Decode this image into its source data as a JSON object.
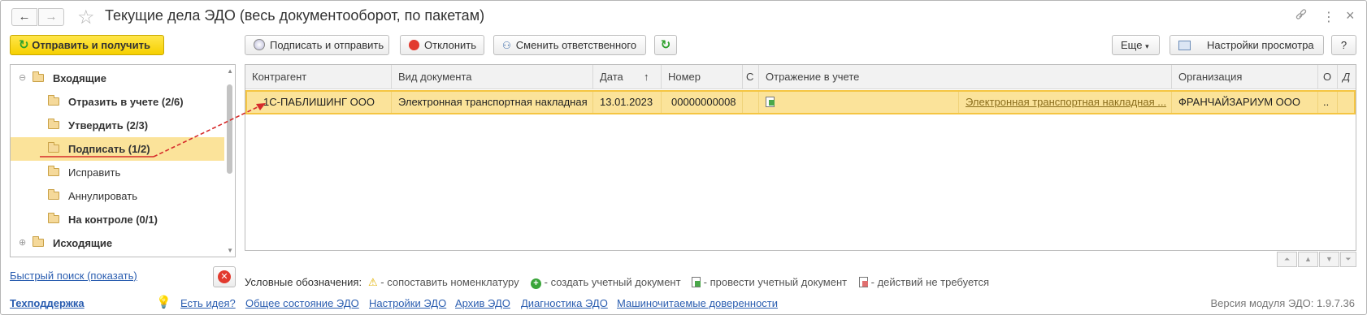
{
  "window": {
    "title": "Текущие дела ЭДО (весь документооборот, по пакетам)",
    "back_icon": "←",
    "forward_icon": "→",
    "link_icon": "🔗",
    "more_icon": "⋮",
    "close_icon": "×"
  },
  "toolbar": {
    "send_receive": "Отправить и получить",
    "sign_send": "Подписать и отправить",
    "reject": "Отклонить",
    "change_responsible": "Сменить ответственного",
    "more": "Еще",
    "view_settings": "Настройки просмотра",
    "help": "?"
  },
  "tree": {
    "items": [
      {
        "label": "Входящие",
        "toggle": "⊖",
        "bold": true
      },
      {
        "label": "Отразить в учете (2/6)",
        "bold": true
      },
      {
        "label": "Утвердить (2/3)",
        "bold": true
      },
      {
        "label": "Подписать (1/2)",
        "bold": true,
        "selected": true
      },
      {
        "label": "Исправить",
        "bold": false
      },
      {
        "label": "Аннулировать",
        "bold": false
      },
      {
        "label": "На контроле (0/1)",
        "bold": true
      },
      {
        "label": "Исходящие",
        "toggle": "⊕",
        "bold": true
      }
    ]
  },
  "grid": {
    "columns": [
      "Контрагент",
      "Вид документа",
      "Дата",
      "Номер",
      "С",
      "Отражение в учете",
      "Организация",
      "О",
      "Д"
    ],
    "sort_indicator": "↑",
    "rows": [
      {
        "counterparty": "1С-ПАБЛИШИНГ ООО",
        "doc_type": "Электронная транспортная накладная",
        "date": "13.01.2023",
        "number": "00000000008",
        "accounting_link": "Электронная транспортная накладная ...",
        "organization": "ФРАНЧАЙЗАРИУМ ООО",
        "extra": ".."
      }
    ]
  },
  "quick_search": "Быстрый поиск (показать)",
  "legend": {
    "title": "Условные обозначения:",
    "items": [
      "- сопоставить номенклатуру",
      "- создать учетный документ",
      "- провести учетный документ",
      "- действий не требуется"
    ]
  },
  "footer": {
    "support": "Техподдержка",
    "idea": "Есть идея?",
    "links": [
      "Общее состояние ЭДО",
      "Настройки ЭДО",
      "Архив ЭДО",
      "Диагностика ЭДО",
      "Машиночитаемые доверенности"
    ],
    "version": "Версия модуля ЭДО: 1.9.7.36"
  }
}
